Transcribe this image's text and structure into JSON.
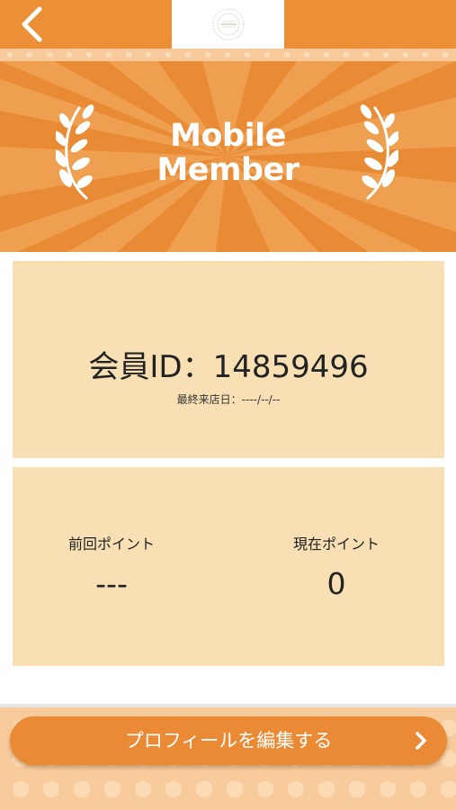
{
  "header": {
    "back_icon": "chevron-left-icon",
    "logo_icon": "shop-logo-icon"
  },
  "hero": {
    "title_line1": "Mobile",
    "title_line2": "Member",
    "decoration_icon": "laurel-icon"
  },
  "member": {
    "id_label": "会員ID：",
    "id_value": "14859496",
    "last_visit_label": "最終来店日：",
    "last_visit_value": "----/--/--"
  },
  "points": {
    "previous_label": "前回ポイント",
    "previous_value": "---",
    "current_label": "現在ポイント",
    "current_value": "0"
  },
  "profile_button": {
    "label": "プロフィールを編集する",
    "icon": "chevron-right-icon"
  },
  "colors": {
    "accent": "#ec9038",
    "hero_background": "#e98a35",
    "card_background": "#f8e0b4",
    "text": "#222222"
  }
}
